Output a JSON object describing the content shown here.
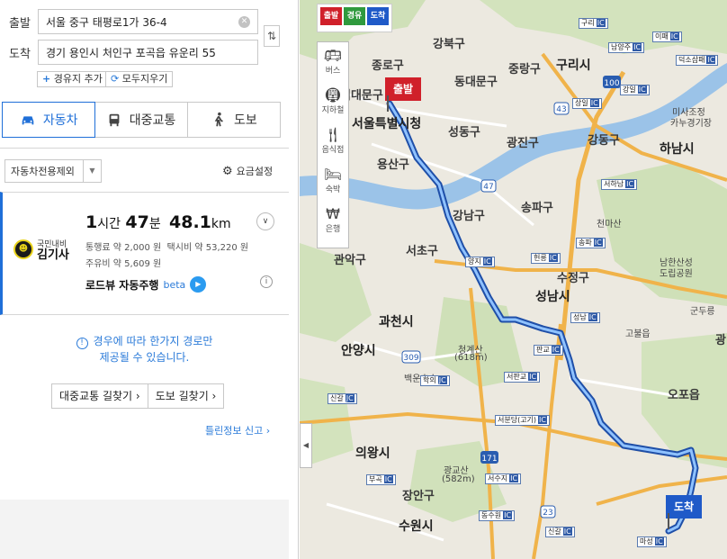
{
  "search": {
    "start_label": "출발",
    "start_value": "서울 중구 태평로1가 36-4",
    "dest_label": "도착",
    "dest_value": "경기 용인시 처인구 포곡읍 유운리 55",
    "add_waypoint": "경유지 추가",
    "clear_all": "모두지우기"
  },
  "modes": [
    {
      "label": "자동차",
      "icon": "car-icon",
      "active": true
    },
    {
      "label": "대중교통",
      "icon": "bus-icon",
      "active": false
    },
    {
      "label": "도보",
      "icon": "walk-icon",
      "active": false
    }
  ],
  "filter": {
    "selected": "자동차전용제외",
    "fare_settings": "요금설정"
  },
  "result": {
    "provider_small": "국민내비",
    "provider_name": "김기사",
    "duration_hours": "1",
    "duration_hours_unit": "시간",
    "duration_minutes": "47",
    "duration_minutes_unit": "분",
    "distance_value": "48.1",
    "distance_unit": "km",
    "toll_label": "통행료",
    "toll_value": "약 2,000 원",
    "taxi_label": "택시비",
    "taxi_value": "약 53,220 원",
    "fuel_label": "주유비",
    "fuel_value": "약 5,609 원",
    "roadview_label": "로드뷰 자동주행",
    "beta": "beta"
  },
  "notice": {
    "line1": "경우에 따라 한가지 경로만",
    "line2": "제공될 수 있습니다."
  },
  "buttons": {
    "transit": "대중교통 길찾기 ›",
    "walk": "도보 길찾기 ›"
  },
  "report_link": "틀린정보 신고 ›",
  "map": {
    "legend": {
      "start": "출발",
      "via": "경유",
      "dest": "도착"
    },
    "categories": [
      "버스",
      "지하철",
      "음식점",
      "숙박",
      "은행"
    ],
    "start_pin": "출발",
    "dest_pin": "도착",
    "labels": {
      "jongno": "종로구",
      "seodaemun": "서대문구",
      "gangbuk": "강북구",
      "dongdaemun": "동대문구",
      "jungnang": "중랑구",
      "guri": "구리시",
      "seoul_city_hall": "서울특별시청",
      "seongdong": "성동구",
      "gwangjin": "광진구",
      "gangdong": "강동구",
      "hanam": "하남시",
      "yongsan": "용산구",
      "songpa": "송파구",
      "gangnam": "강남구",
      "seocho": "서초구",
      "sujeong": "수정구",
      "seongnam": "성남시",
      "gwanak": "관악구",
      "gwacheon": "과천시",
      "anyang": "안양시",
      "uiwang": "의왕시",
      "suwon": "수원시",
      "jangan": "장안구",
      "opo": "오포읍",
      "cheongge": "청계산",
      "cheongge_h": "(618m)",
      "gwanggyo": "광교산",
      "gwanggyo_h": "(582m)",
      "baegun": "백운호수",
      "cheonma": "천마산",
      "namhan": "남한산성",
      "namhan2": "도립공원",
      "misa": "미사조정",
      "misa2": "카누경기장",
      "gundong": "군두릉",
      "gobul": "고불읍",
      "gwang": "광"
    },
    "ics": [
      {
        "name": "구리",
        "suffix": "IC"
      },
      {
        "name": "남양주",
        "suffix": "IC"
      },
      {
        "name": "이패",
        "suffix": "IC"
      },
      {
        "name": "덕소삼패",
        "suffix": "IC"
      },
      {
        "name": "강일",
        "suffix": "IC"
      },
      {
        "name": "상일",
        "suffix": "IC"
      },
      {
        "name": "서하남",
        "suffix": "IC"
      },
      {
        "name": "양지",
        "suffix": "IC"
      },
      {
        "name": "헌릉",
        "suffix": "IC"
      },
      {
        "name": "송파",
        "suffix": "IC"
      },
      {
        "name": "성남",
        "suffix": "IC"
      },
      {
        "name": "판교",
        "suffix": "IC"
      },
      {
        "name": "서판교",
        "suffix": "IC"
      },
      {
        "name": "학의",
        "suffix": "JC"
      },
      {
        "name": "신갈",
        "suffix": "JC"
      },
      {
        "name": "서분당(고기)",
        "suffix": "IC"
      },
      {
        "name": "서수지",
        "suffix": "IC"
      },
      {
        "name": "부곡",
        "suffix": "IC"
      },
      {
        "name": "동수원",
        "suffix": "IC"
      },
      {
        "name": "신갈",
        "suffix": "IC"
      },
      {
        "name": "마성",
        "suffix": "IC"
      }
    ],
    "road_numbers": [
      "100",
      "43",
      "47",
      "309",
      "171",
      "23"
    ]
  }
}
